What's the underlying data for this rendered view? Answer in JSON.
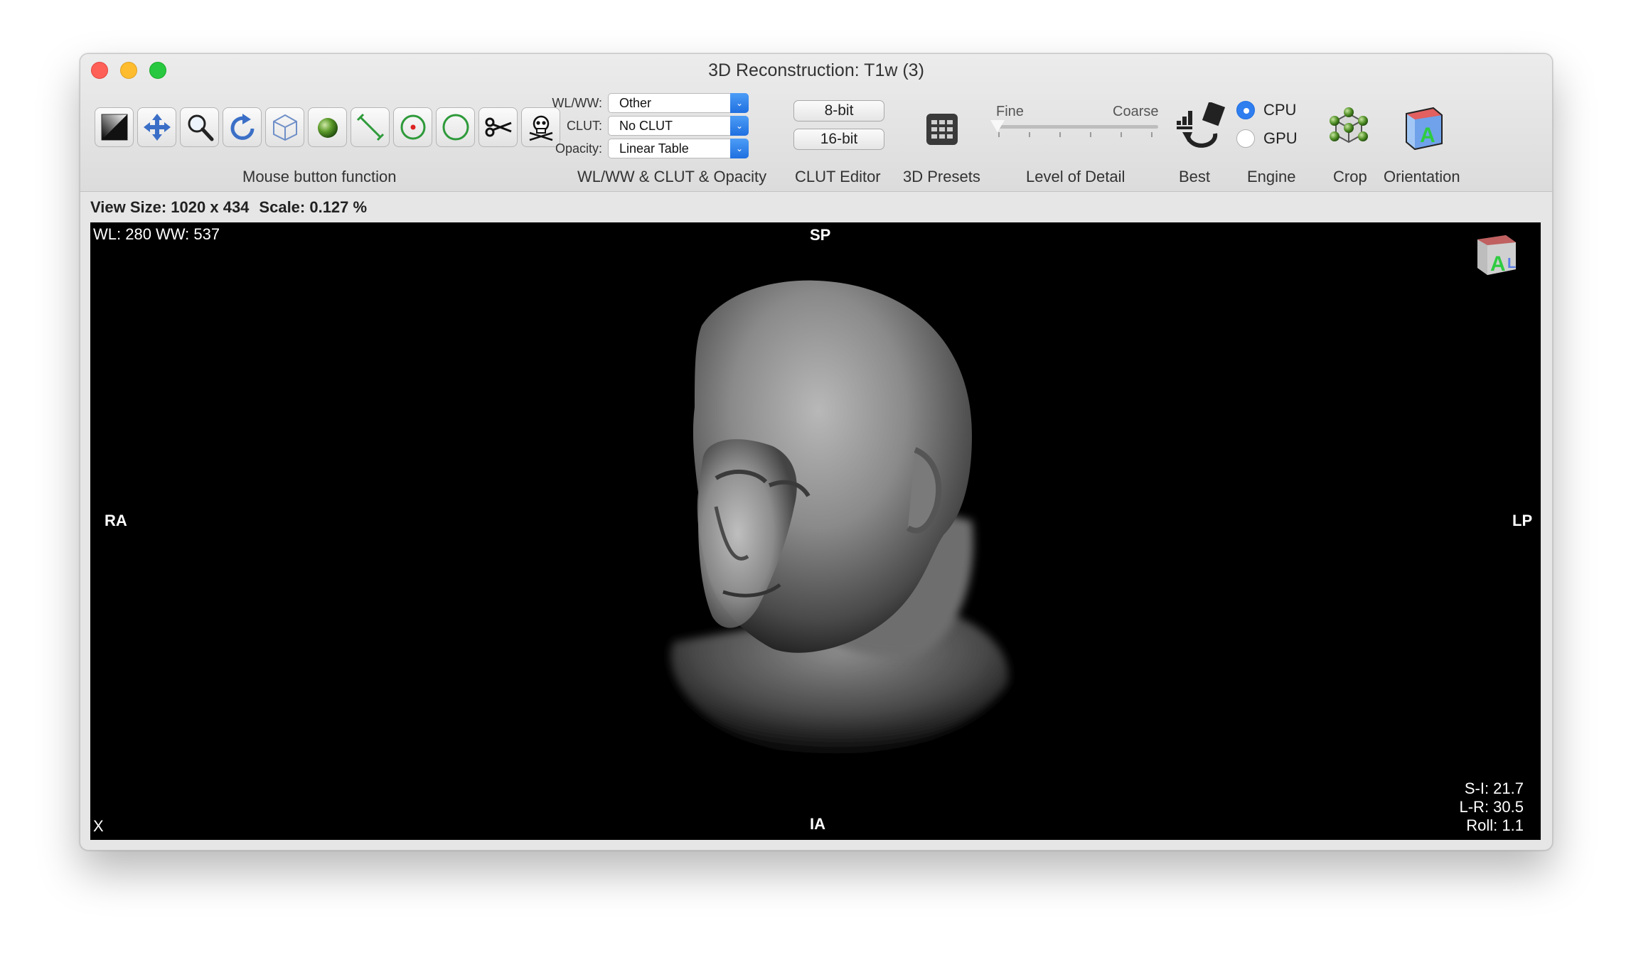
{
  "window": {
    "title": "3D Reconstruction: T1w (3)"
  },
  "toolbar": {
    "mouse_tools_label": "Mouse button function",
    "wl_label": "WL/WW:",
    "wl_value": "Other",
    "clut_label": "CLUT:",
    "clut_value": "No CLUT",
    "opacity_label": "Opacity:",
    "opacity_value": "Linear Table",
    "wl_group_label": "WL/WW & CLUT & Opacity",
    "bit8": "8-bit",
    "bit16": "16-bit",
    "clut_editor_label": "CLUT Editor",
    "presets_label": "3D Presets",
    "fine": "Fine",
    "coarse": "Coarse",
    "lod_label": "Level of Detail",
    "lod_value": 0.0,
    "best_label": "Best",
    "cpu": "CPU",
    "gpu": "GPU",
    "engine_selected": "CPU",
    "engine_label": "Engine",
    "crop_label": "Crop",
    "orientation_label": "Orientation"
  },
  "status": {
    "view_size": "View Size: 1020 x 434",
    "scale": "Scale: 0.127 %"
  },
  "viewer": {
    "wl_ww": "WL: 280 WW: 537",
    "top": "SP",
    "bottom": "IA",
    "left": "RA",
    "right": "LP",
    "corner_x": "X",
    "si": "S-I: 21.7",
    "lr": "L-R: 30.5",
    "roll": "Roll: 1.1"
  },
  "colors": {
    "accent": "#2f7ef0",
    "viewer_bg": "#000000",
    "close": "#fe5f57",
    "minimize": "#febc2e",
    "zoom": "#28c840"
  }
}
